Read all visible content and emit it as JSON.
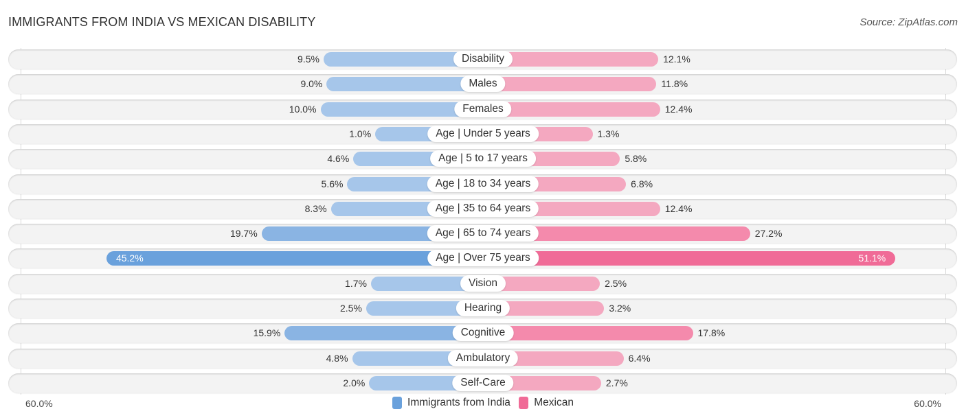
{
  "header": {
    "title": "IMMIGRANTS FROM INDIA VS MEXICAN DISABILITY",
    "source": "Source: ZipAtlas.com"
  },
  "colors": {
    "india_light": "#a6c6ea",
    "india_strong": "#6aa1dc",
    "mexican_light": "#f4a8c0",
    "mexican_strong": "#f06b97",
    "row_bg": "#f3f3f3"
  },
  "chart_data": {
    "type": "bar",
    "orientation": "horizontal-diverging",
    "title": "IMMIGRANTS FROM INDIA VS MEXICAN DISABILITY",
    "categories": [
      "Disability",
      "Males",
      "Females",
      "Age | Under 5 years",
      "Age | 5 to 17 years",
      "Age | 18 to 34 years",
      "Age | 35 to 64 years",
      "Age | 65 to 74 years",
      "Age | Over 75 years",
      "Vision",
      "Hearing",
      "Cognitive",
      "Ambulatory",
      "Self-Care"
    ],
    "series": [
      {
        "name": "Immigrants from India",
        "side": "left",
        "values": [
          9.5,
          9.0,
          10.0,
          1.0,
          4.6,
          5.6,
          8.3,
          19.7,
          45.2,
          1.7,
          2.5,
          15.9,
          4.8,
          2.0
        ],
        "labels": [
          "9.5%",
          "9.0%",
          "10.0%",
          "1.0%",
          "4.6%",
          "5.6%",
          "8.3%",
          "19.7%",
          "45.2%",
          "1.7%",
          "2.5%",
          "15.9%",
          "4.8%",
          "2.0%"
        ]
      },
      {
        "name": "Mexican",
        "side": "right",
        "values": [
          12.1,
          11.8,
          12.4,
          1.3,
          5.8,
          6.8,
          12.4,
          27.2,
          51.1,
          2.5,
          3.2,
          17.8,
          6.4,
          2.7
        ],
        "labels": [
          "12.1%",
          "11.8%",
          "12.4%",
          "1.3%",
          "5.8%",
          "6.8%",
          "12.4%",
          "27.2%",
          "51.1%",
          "2.5%",
          "3.2%",
          "17.8%",
          "6.4%",
          "2.7%"
        ]
      }
    ],
    "xlim": [
      -60,
      60
    ],
    "axis_labels": {
      "left": "60.0%",
      "right": "60.0%"
    },
    "legend": {
      "position": "bottom-center",
      "entries": [
        "Immigrants from India",
        "Mexican"
      ]
    },
    "grid": false
  }
}
